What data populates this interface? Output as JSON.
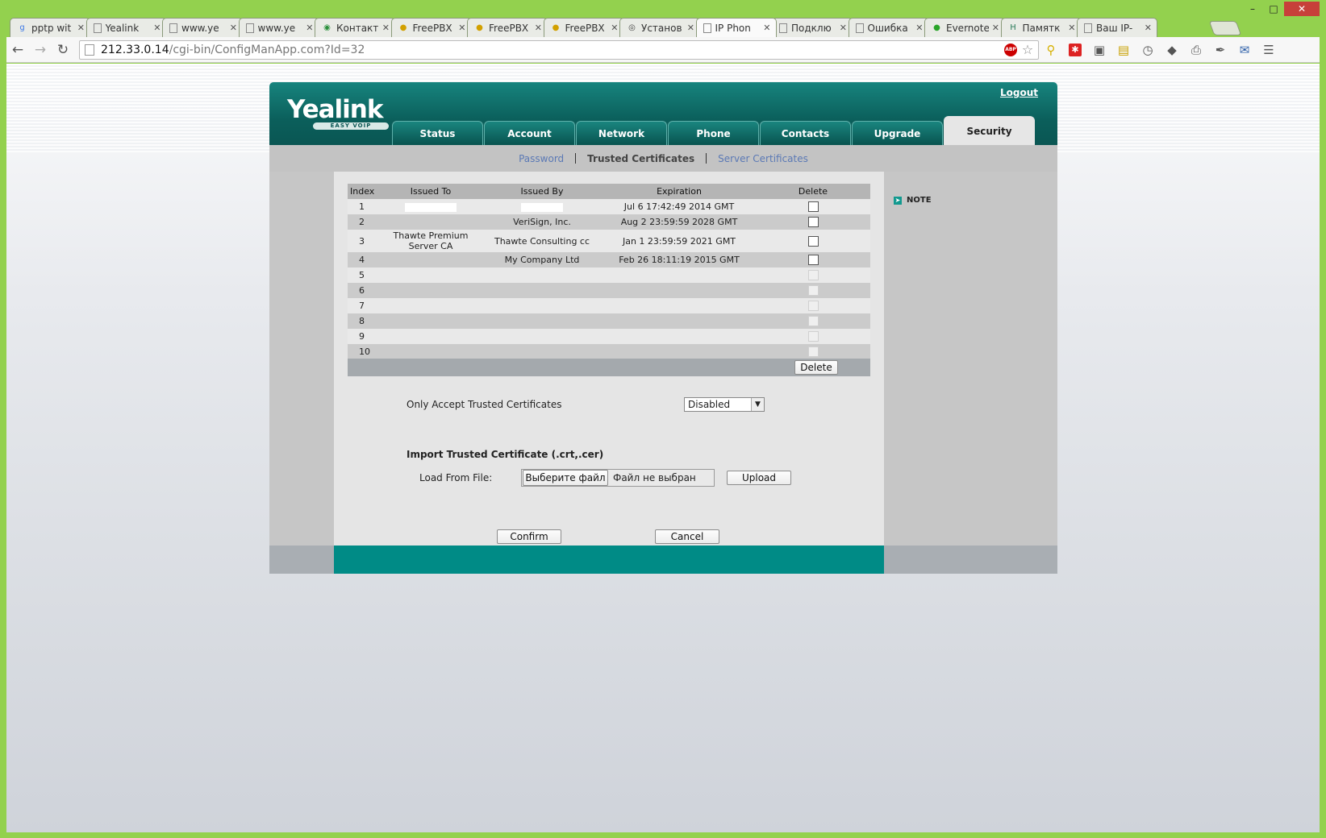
{
  "browser": {
    "tabs": [
      {
        "label": "pptp wit",
        "icon": "google-icon",
        "active": false
      },
      {
        "label": "Yealink",
        "icon": "page-icon",
        "active": false
      },
      {
        "label": "www.ye",
        "icon": "page-icon",
        "active": false
      },
      {
        "label": "www.ye",
        "icon": "page-icon",
        "active": false
      },
      {
        "label": "Контакт",
        "icon": "globe-icon",
        "active": false
      },
      {
        "label": "FreePBX",
        "icon": "freepbx-icon",
        "active": false
      },
      {
        "label": "FreePBX",
        "icon": "freepbx-icon",
        "active": false
      },
      {
        "label": "FreePBX",
        "icon": "freepbx-icon",
        "active": false
      },
      {
        "label": "Установ",
        "icon": "wordpress-icon",
        "active": false
      },
      {
        "label": "IP Phon",
        "icon": "page-icon",
        "active": true
      },
      {
        "label": "Подклю",
        "icon": "page-icon",
        "active": false
      },
      {
        "label": "Ошибка",
        "icon": "page-icon",
        "active": false
      },
      {
        "label": "Evernote",
        "icon": "evernote-icon",
        "active": false
      },
      {
        "label": "Памятк",
        "icon": "h-icon",
        "active": false
      },
      {
        "label": "Ваш IP-",
        "icon": "page-icon",
        "active": false
      }
    ],
    "url_host": "212.33.0.14",
    "url_path": "/cgi-bin/ConfigManApp.com?Id=32",
    "abp_badge": "ABP"
  },
  "header": {
    "logo": "Yealink",
    "logo_sub": "EASY VOIP",
    "logout": "Logout"
  },
  "nav": {
    "tabs": [
      "Status",
      "Account",
      "Network",
      "Phone",
      "Contacts",
      "Upgrade",
      "Security"
    ],
    "active": "Security"
  },
  "subnav": {
    "password": "Password",
    "trusted": "Trusted Certificates",
    "server": "Server Certificates"
  },
  "table": {
    "headers": {
      "index": "Index",
      "issued_to": "Issued To",
      "issued_by": "Issued By",
      "expiration": "Expiration",
      "delete": "Delete"
    },
    "rows": [
      {
        "index": "1",
        "issued_to": "",
        "issued_by": "",
        "expiration": "Jul 6 17:42:49 2014 GMT"
      },
      {
        "index": "2",
        "issued_to": "",
        "issued_by": "VeriSign, Inc.",
        "expiration": "Aug 2 23:59:59 2028 GMT"
      },
      {
        "index": "3",
        "issued_to": "Thawte Premium Server CA",
        "issued_by": "Thawte Consulting cc",
        "expiration": "Jan 1 23:59:59 2021 GMT"
      },
      {
        "index": "4",
        "issued_to": "",
        "issued_by": "My Company Ltd",
        "expiration": "Feb 26 18:11:19 2015 GMT"
      },
      {
        "index": "5",
        "issued_to": "",
        "issued_by": "",
        "expiration": ""
      },
      {
        "index": "6",
        "issued_to": "",
        "issued_by": "",
        "expiration": ""
      },
      {
        "index": "7",
        "issued_to": "",
        "issued_by": "",
        "expiration": ""
      },
      {
        "index": "8",
        "issued_to": "",
        "issued_by": "",
        "expiration": ""
      },
      {
        "index": "9",
        "issued_to": "",
        "issued_by": "",
        "expiration": ""
      },
      {
        "index": "10",
        "issued_to": "",
        "issued_by": "",
        "expiration": ""
      }
    ],
    "delete_button": "Delete"
  },
  "form": {
    "only_accept_label": "Only Accept Trusted Certificates",
    "only_accept_value": "Disabled",
    "import_heading": "Import Trusted Certificate (.crt,.cer)",
    "load_label": "Load From File:",
    "choose_file": "Выберите файл",
    "no_file": "Файл не выбран",
    "upload": "Upload",
    "confirm": "Confirm",
    "cancel": "Cancel"
  },
  "note": {
    "label": "NOTE"
  },
  "colors": {
    "brand_teal": "#0b6b66",
    "footer_teal": "#008b86"
  }
}
